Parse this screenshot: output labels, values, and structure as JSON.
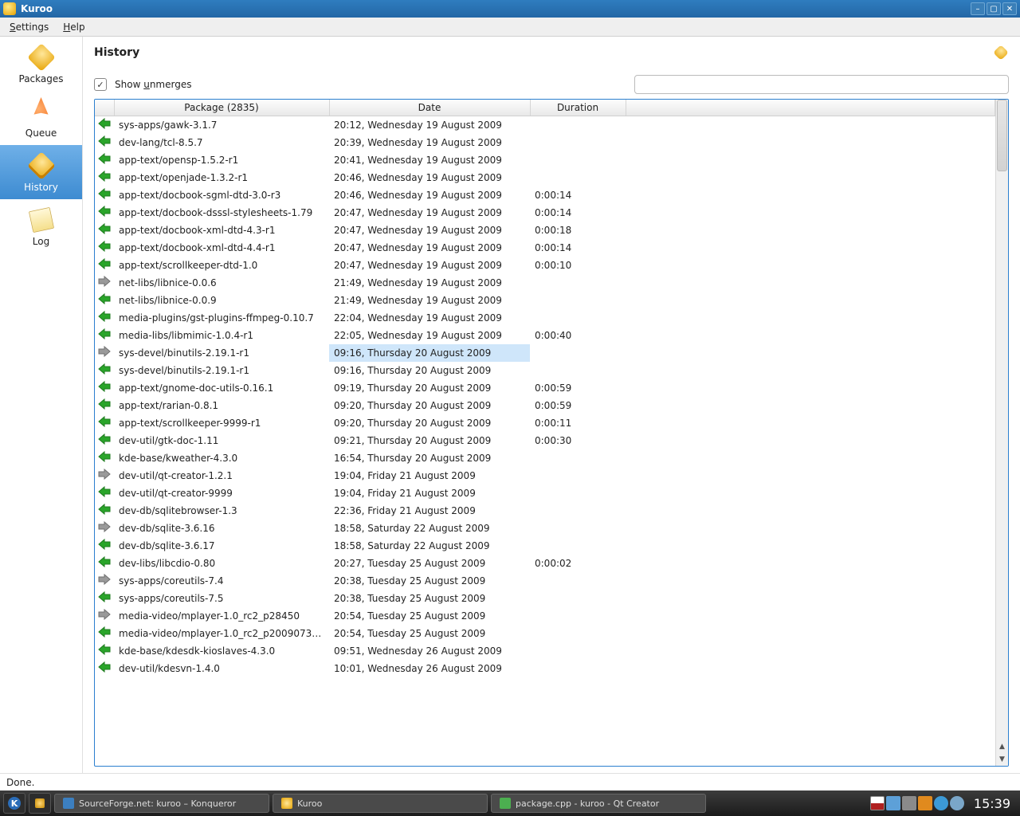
{
  "titlebar": {
    "title": "Kuroo"
  },
  "menubar": {
    "settings": "Settings",
    "help": "Help"
  },
  "sidebar": {
    "packages": "Packages",
    "queue": "Queue",
    "history": "History",
    "log": "Log"
  },
  "page": {
    "title": "History"
  },
  "filter": {
    "show_unmerges": "Show unmerges"
  },
  "columns": {
    "package": "Package (2835)",
    "date": "Date",
    "duration": "Duration"
  },
  "rows": [
    {
      "dir": "in",
      "pkg": "sys-apps/gawk-3.1.7",
      "date": "20:12, Wednesday 19 August 2009",
      "dur": ""
    },
    {
      "dir": "in",
      "pkg": "dev-lang/tcl-8.5.7",
      "date": "20:39, Wednesday 19 August 2009",
      "dur": ""
    },
    {
      "dir": "in",
      "pkg": "app-text/opensp-1.5.2-r1",
      "date": "20:41, Wednesday 19 August 2009",
      "dur": ""
    },
    {
      "dir": "in",
      "pkg": "app-text/openjade-1.3.2-r1",
      "date": "20:46, Wednesday 19 August 2009",
      "dur": ""
    },
    {
      "dir": "in",
      "pkg": "app-text/docbook-sgml-dtd-3.0-r3",
      "date": "20:46, Wednesday 19 August 2009",
      "dur": "0:00:14"
    },
    {
      "dir": "in",
      "pkg": "app-text/docbook-dsssl-stylesheets-1.79",
      "date": "20:47, Wednesday 19 August 2009",
      "dur": "0:00:14"
    },
    {
      "dir": "in",
      "pkg": "app-text/docbook-xml-dtd-4.3-r1",
      "date": "20:47, Wednesday 19 August 2009",
      "dur": "0:00:18"
    },
    {
      "dir": "in",
      "pkg": "app-text/docbook-xml-dtd-4.4-r1",
      "date": "20:47, Wednesday 19 August 2009",
      "dur": "0:00:14"
    },
    {
      "dir": "in",
      "pkg": "app-text/scrollkeeper-dtd-1.0",
      "date": "20:47, Wednesday 19 August 2009",
      "dur": "0:00:10"
    },
    {
      "dir": "out",
      "pkg": "net-libs/libnice-0.0.6",
      "date": "21:49, Wednesday 19 August 2009",
      "dur": ""
    },
    {
      "dir": "in",
      "pkg": "net-libs/libnice-0.0.9",
      "date": "21:49, Wednesday 19 August 2009",
      "dur": ""
    },
    {
      "dir": "in",
      "pkg": "media-plugins/gst-plugins-ffmpeg-0.10.7",
      "date": "22:04, Wednesday 19 August 2009",
      "dur": ""
    },
    {
      "dir": "in",
      "pkg": "media-libs/libmimic-1.0.4-r1",
      "date": "22:05, Wednesday 19 August 2009",
      "dur": "0:00:40"
    },
    {
      "dir": "out",
      "pkg": "sys-devel/binutils-2.19.1-r1",
      "date": "09:16, Thursday 20 August 2009",
      "dur": "",
      "hl": true
    },
    {
      "dir": "in",
      "pkg": "sys-devel/binutils-2.19.1-r1",
      "date": "09:16, Thursday 20 August 2009",
      "dur": ""
    },
    {
      "dir": "in",
      "pkg": "app-text/gnome-doc-utils-0.16.1",
      "date": "09:19, Thursday 20 August 2009",
      "dur": "0:00:59"
    },
    {
      "dir": "in",
      "pkg": "app-text/rarian-0.8.1",
      "date": "09:20, Thursday 20 August 2009",
      "dur": "0:00:59"
    },
    {
      "dir": "in",
      "pkg": "app-text/scrollkeeper-9999-r1",
      "date": "09:20, Thursday 20 August 2009",
      "dur": "0:00:11"
    },
    {
      "dir": "in",
      "pkg": "dev-util/gtk-doc-1.11",
      "date": "09:21, Thursday 20 August 2009",
      "dur": "0:00:30"
    },
    {
      "dir": "in",
      "pkg": "kde-base/kweather-4.3.0",
      "date": "16:54, Thursday 20 August 2009",
      "dur": ""
    },
    {
      "dir": "out",
      "pkg": "dev-util/qt-creator-1.2.1",
      "date": "19:04, Friday 21 August 2009",
      "dur": ""
    },
    {
      "dir": "in",
      "pkg": "dev-util/qt-creator-9999",
      "date": "19:04, Friday 21 August 2009",
      "dur": ""
    },
    {
      "dir": "in",
      "pkg": "dev-db/sqlitebrowser-1.3",
      "date": "22:36, Friday 21 August 2009",
      "dur": ""
    },
    {
      "dir": "out",
      "pkg": "dev-db/sqlite-3.6.16",
      "date": "18:58, Saturday 22 August 2009",
      "dur": ""
    },
    {
      "dir": "in",
      "pkg": "dev-db/sqlite-3.6.17",
      "date": "18:58, Saturday 22 August 2009",
      "dur": ""
    },
    {
      "dir": "in",
      "pkg": "dev-libs/libcdio-0.80",
      "date": "20:27, Tuesday 25 August 2009",
      "dur": "0:00:02"
    },
    {
      "dir": "out",
      "pkg": "sys-apps/coreutils-7.4",
      "date": "20:38, Tuesday 25 August 2009",
      "dur": ""
    },
    {
      "dir": "in",
      "pkg": "sys-apps/coreutils-7.5",
      "date": "20:38, Tuesday 25 August 2009",
      "dur": ""
    },
    {
      "dir": "out",
      "pkg": "media-video/mplayer-1.0_rc2_p28450",
      "date": "20:54, Tuesday 25 August 2009",
      "dur": ""
    },
    {
      "dir": "in",
      "pkg": "media-video/mplayer-1.0_rc2_p2009073…",
      "date": "20:54, Tuesday 25 August 2009",
      "dur": ""
    },
    {
      "dir": "in",
      "pkg": "kde-base/kdesdk-kioslaves-4.3.0",
      "date": "09:51, Wednesday 26 August 2009",
      "dur": ""
    },
    {
      "dir": "in",
      "pkg": "dev-util/kdesvn-1.4.0",
      "date": "10:01, Wednesday 26 August 2009",
      "dur": ""
    }
  ],
  "status": {
    "message": "Done."
  },
  "taskbar": {
    "t1": "SourceForge.net: kuroo – Konqueror",
    "t2": "Kuroo",
    "t3": "package.cpp - kuroo - Qt Creator",
    "clock": "15:39"
  },
  "tray": {
    "flag": "#b02020",
    "net": "#5da0d8",
    "snd": "#8a8a8a",
    "upd": "#e08a1e",
    "browser": "#3c9ad6",
    "info": "#7aa6c8"
  }
}
